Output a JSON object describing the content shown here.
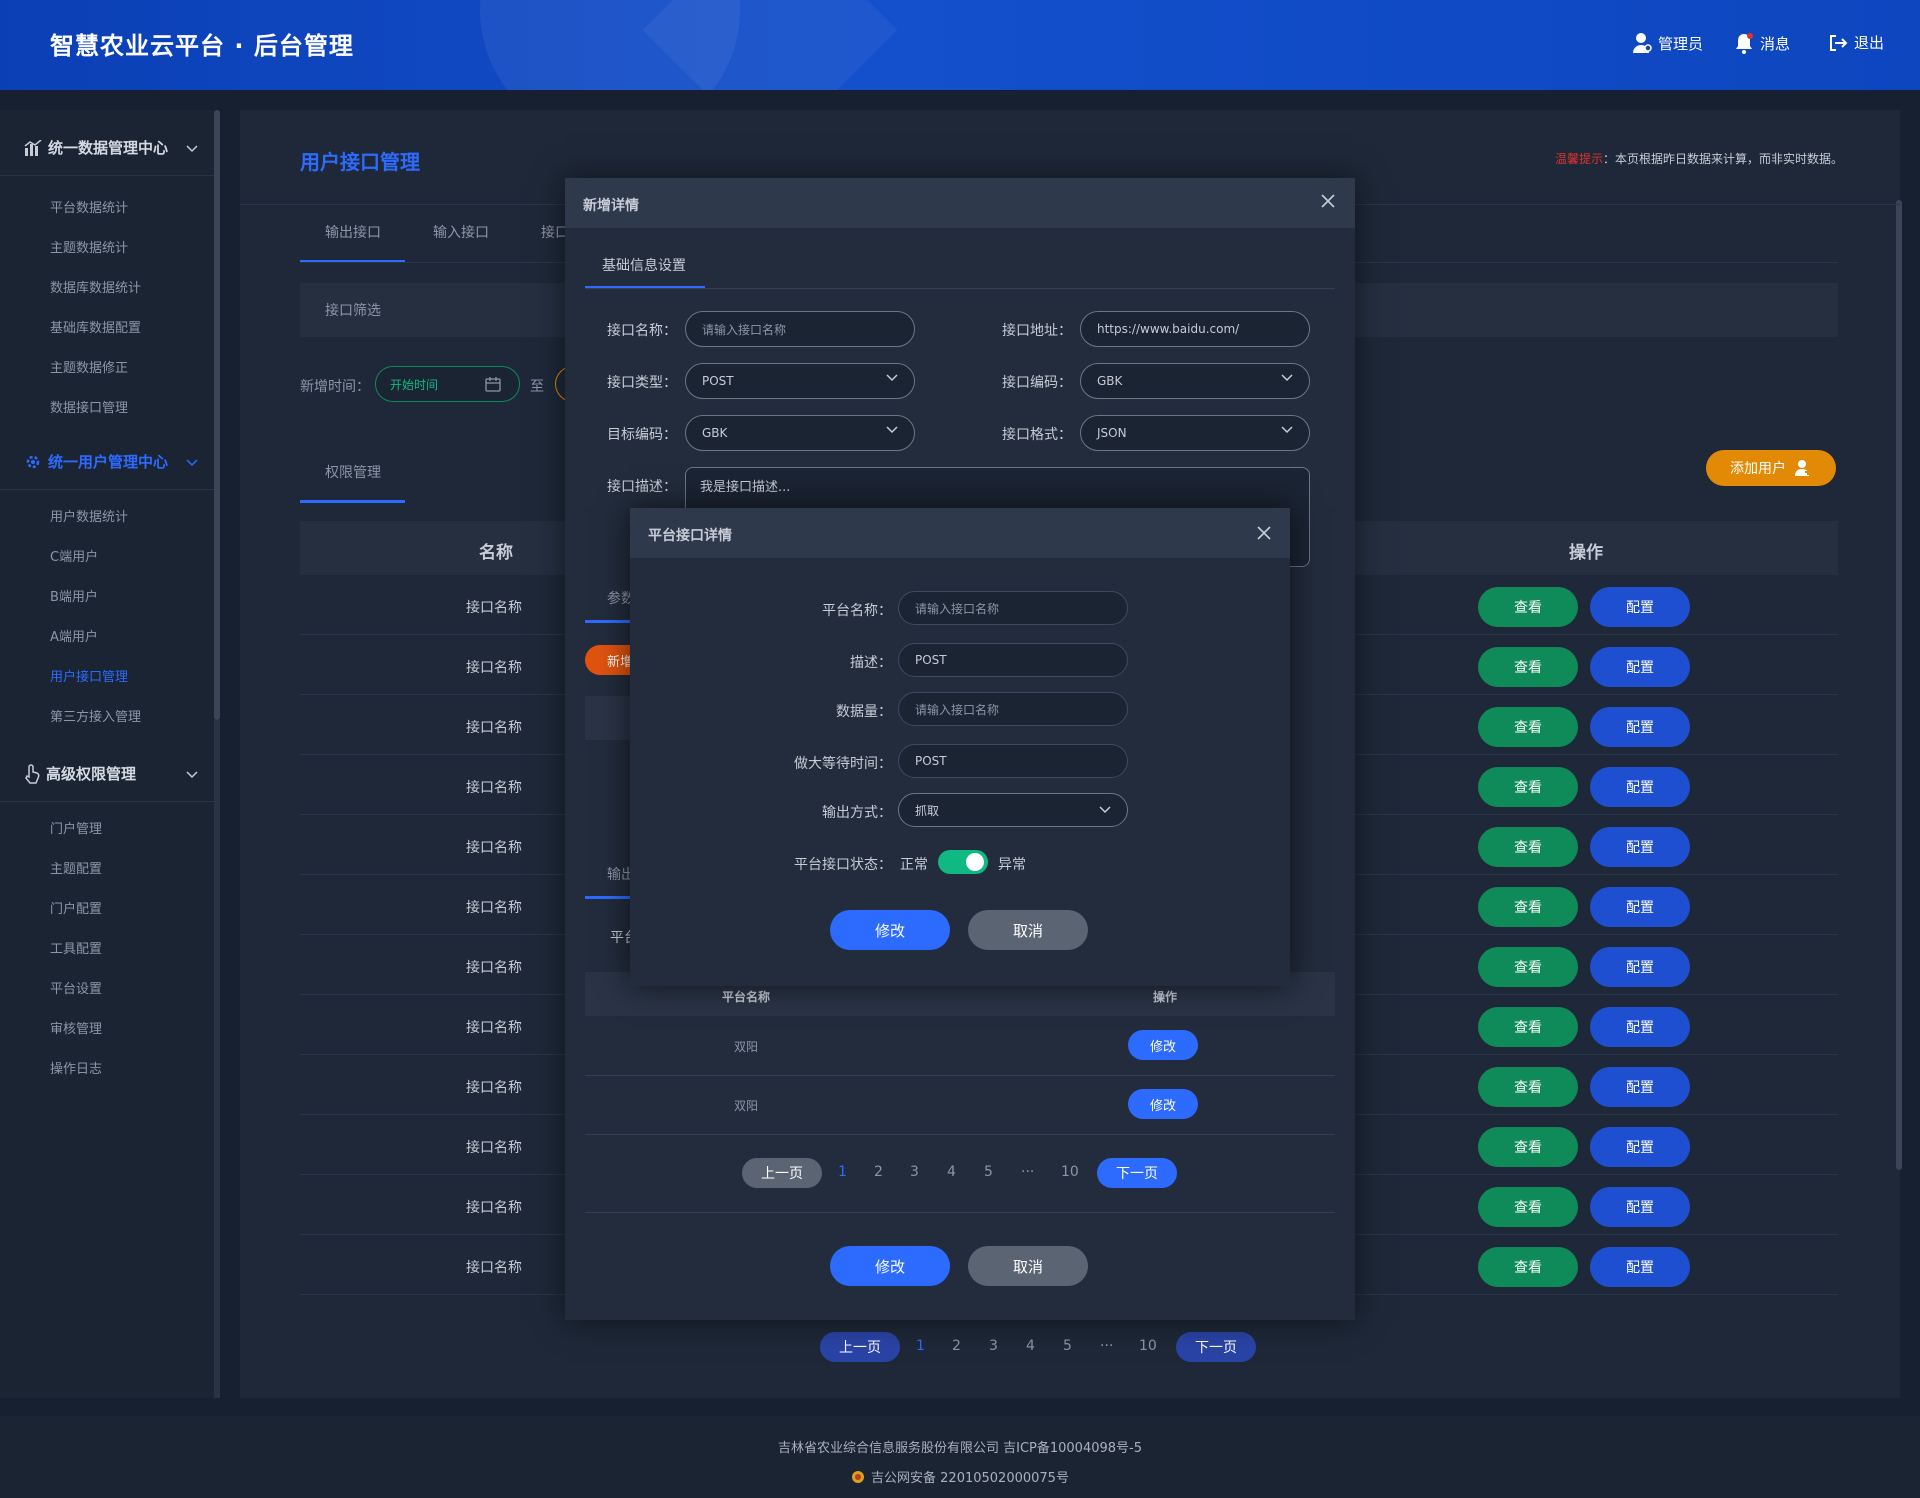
{
  "header": {
    "title": "智慧农业云平台 · 后台管理",
    "admin_label": "管理员",
    "message_label": "消息",
    "logout_label": "退出"
  },
  "sidebar": {
    "groups": [
      {
        "label": "统一数据管理中心",
        "icon": "chart-icon",
        "items": [
          "平台数据统计",
          "主题数据统计",
          "数据库数据统计",
          "基础库数据配置",
          "主题数据修正",
          "数据接口管理"
        ]
      },
      {
        "label": "统一用户管理中心",
        "icon": "gear-icon",
        "items": [
          "用户数据统计",
          "C端用户",
          "B端用户",
          "A端用户",
          "用户接口管理",
          "第三方接入管理"
        ]
      },
      {
        "label": "高级权限管理",
        "icon": "hand-pointer-icon",
        "items": [
          "门户管理",
          "主题配置",
          "门户配置",
          "工具配置",
          "平台设置",
          "审核管理",
          "操作日志"
        ]
      }
    ],
    "active_item": "用户接口管理"
  },
  "page": {
    "title": "用户接口管理",
    "notice_label": "温馨提示",
    "notice_text": "：本页根据昨日数据来计算，而非实时数据。",
    "tabs": [
      "输出接口",
      "输入接口",
      "接口"
    ],
    "filter_title": "接口筛选",
    "date_label": "新增时间：",
    "date_placeholder": "开始时间",
    "date_to": "至",
    "perm_tab": "权限管理",
    "add_user": "添加用户",
    "columns": {
      "name": "名称",
      "action": "操作"
    },
    "rows": [
      "接口名称",
      "接口名称",
      "接口名称",
      "接口名称",
      "接口名称",
      "接口名称",
      "接口名称",
      "接口名称",
      "接口名称",
      "接口名称",
      "接口名称",
      "接口名称"
    ],
    "view_label": "查看",
    "config_label": "配置",
    "pager": {
      "prev": "上一页",
      "next": "下一页",
      "pages": [
        "1",
        "2",
        "3",
        "4",
        "5",
        "···",
        "10"
      ],
      "current": "1"
    }
  },
  "modal_add": {
    "title": "新增详情",
    "tab": "基础信息设置",
    "fields": {
      "name_label": "接口名称：",
      "name_placeholder": "请输入接口名称",
      "addr_label": "接口地址：",
      "addr_value": "https://www.baidu.com/",
      "type_label": "接口类型：",
      "type_value": "POST",
      "encode_label": "接口编码：",
      "encode_value": "GBK",
      "target_label": "目标编码：",
      "target_value": "GBK",
      "format_label": "接口格式：",
      "format_value": "JSON",
      "desc_label": "接口描述：",
      "desc_value": "我是接口描述..."
    },
    "partial_tab1": "参数",
    "partial_btn": "新增",
    "partial_tab2": "输出",
    "partial_label": "平台",
    "inner_table": {
      "col1": "平台名称",
      "col2": "操作",
      "rows": [
        "双阳",
        "双阳"
      ],
      "edit_label": "修改"
    },
    "pager": {
      "prev": "上一页",
      "next": "下一页",
      "pages": [
        "1",
        "2",
        "3",
        "4",
        "5",
        "···",
        "10"
      ],
      "current": "1"
    },
    "ok": "修改",
    "cancel": "取消"
  },
  "modal_platform": {
    "title": "平台接口详情",
    "name_label": "平台名称：",
    "name_placeholder": "请输入接口名称",
    "desc_label": "描述：",
    "desc_value": "POST",
    "count_label": "数据量：",
    "count_placeholder": "请输入接口名称",
    "wait_label": "做大等待时间：",
    "wait_value": "POST",
    "output_label": "输出方式：",
    "output_value": "抓取",
    "status_label": "平台接口状态：",
    "status_on": "正常",
    "status_off": "异常",
    "ok": "修改",
    "cancel": "取消"
  },
  "footer": {
    "line1": "吉林省农业综合信息服务股份有限公司    吉ICP备10004098号-5",
    "line2": "吉公网安备 22010502000075号"
  },
  "colors": {
    "accent": "#2d6bff",
    "green": "#0f8a59",
    "orange": "#e28a06",
    "danger": "#e0322d"
  }
}
